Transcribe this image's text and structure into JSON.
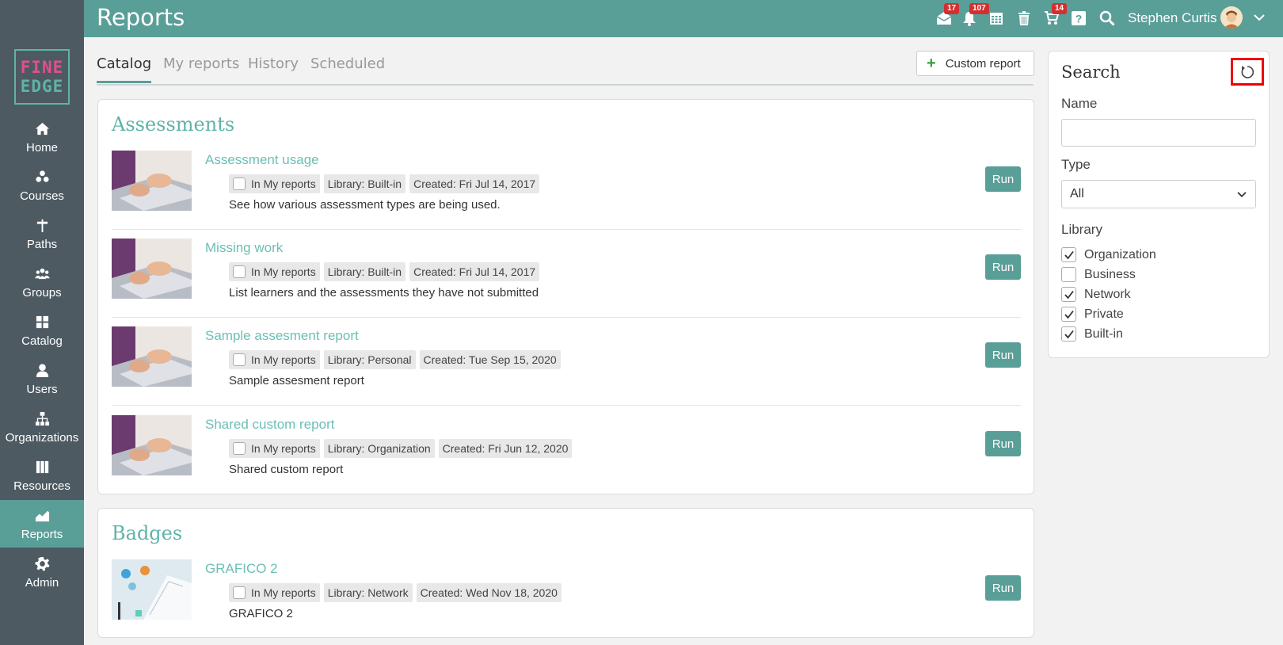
{
  "header": {
    "title": "Reports",
    "icons": [
      {
        "name": "messages-icon",
        "badge": "17"
      },
      {
        "name": "notifications-icon",
        "badge": "107"
      },
      {
        "name": "calendar-icon",
        "badge": ""
      },
      {
        "name": "trash-icon",
        "badge": ""
      },
      {
        "name": "cart-icon",
        "badge": "14"
      },
      {
        "name": "help-icon",
        "badge": ""
      },
      {
        "name": "search-icon",
        "badge": ""
      }
    ],
    "user_name": "Stephen Curtis"
  },
  "logo": {
    "line1": "FINE",
    "line2": "EDGE"
  },
  "sidebar": {
    "items": [
      {
        "label": "Home",
        "icon": "home-icon"
      },
      {
        "label": "Courses",
        "icon": "courses-icon"
      },
      {
        "label": "Paths",
        "icon": "paths-icon"
      },
      {
        "label": "Groups",
        "icon": "groups-icon"
      },
      {
        "label": "Catalog",
        "icon": "catalog-icon"
      },
      {
        "label": "Users",
        "icon": "user-icon"
      },
      {
        "label": "Organizations",
        "icon": "org-chart-icon"
      },
      {
        "label": "Resources",
        "icon": "resources-icon"
      },
      {
        "label": "Reports",
        "icon": "reports-icon",
        "active": true
      },
      {
        "label": "Admin",
        "icon": "gear-icon"
      }
    ]
  },
  "tabs": [
    {
      "label": "Catalog",
      "active": true
    },
    {
      "label": "My reports"
    },
    {
      "label": "History"
    },
    {
      "label": "Scheduled"
    }
  ],
  "custom_report_label": "Custom report",
  "sections": [
    {
      "title": "Assessments",
      "reports": [
        {
          "name": "Assessment usage",
          "in_my_reports": "In My reports",
          "library": "Library: Built-in",
          "created": "Created: Fri Jul 14, 2017",
          "description": "See how various assessment types are being used.",
          "run": "Run"
        },
        {
          "name": "Missing work",
          "in_my_reports": "In My reports",
          "library": "Library: Built-in",
          "created": "Created: Fri Jul 14, 2017",
          "description": "List learners and the assessments they have not submitted",
          "run": "Run"
        },
        {
          "name": "Sample assesment report",
          "in_my_reports": "In My reports",
          "library": "Library: Personal",
          "created": "Created: Tue Sep 15, 2020",
          "description": "Sample assesment report",
          "run": "Run"
        },
        {
          "name": "Shared custom report",
          "in_my_reports": "In My reports",
          "library": "Library: Organization",
          "created": "Created: Fri Jun 12, 2020",
          "description": "Shared custom report",
          "run": "Run"
        }
      ]
    },
    {
      "title": "Badges",
      "reports": [
        {
          "name": "GRAFICO 2",
          "in_my_reports": "In My reports",
          "library": "Library: Network",
          "created": "Created: Wed Nov 18, 2020",
          "description": "GRAFICO 2",
          "run": "Run"
        }
      ]
    }
  ],
  "search": {
    "title": "Search",
    "name_label": "Name",
    "name_value": "",
    "type_label": "Type",
    "type_value": "All",
    "library_label": "Library",
    "library_options": [
      {
        "label": "Organization",
        "checked": true
      },
      {
        "label": "Business",
        "checked": false
      },
      {
        "label": "Network",
        "checked": true
      },
      {
        "label": "Private",
        "checked": true
      },
      {
        "label": "Built-in",
        "checked": true
      }
    ]
  },
  "colors": {
    "header": "#5a9e98",
    "sidebar": "#4d5a62",
    "accent": "#5fb3a8",
    "run_button": "#5a9e98",
    "highlight": "#ee0000"
  }
}
